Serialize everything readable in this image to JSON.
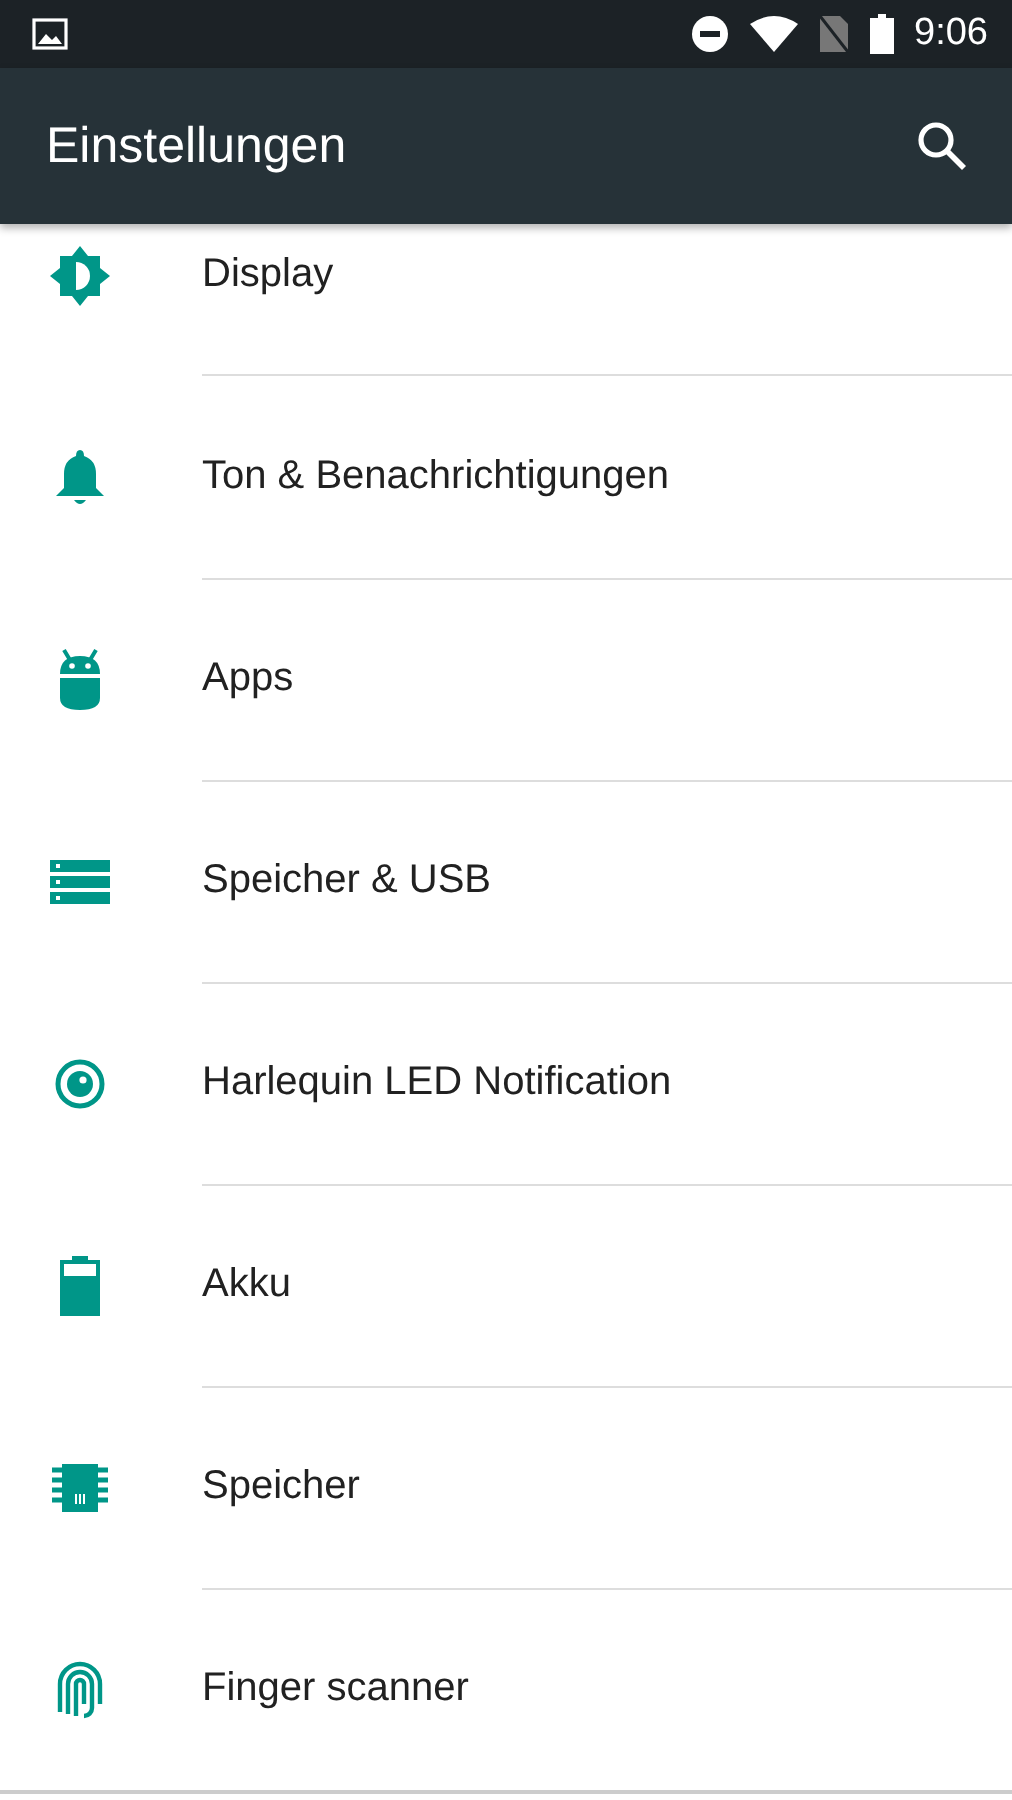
{
  "status_bar": {
    "time": "9:06"
  },
  "app_bar": {
    "title": "Einstellungen"
  },
  "items": [
    {
      "label": "Display",
      "kind": "display"
    },
    {
      "label": "Ton & Benachrichtigungen",
      "kind": "bell"
    },
    {
      "label": "Apps",
      "kind": "android"
    },
    {
      "label": "Speicher & USB",
      "kind": "storage"
    },
    {
      "label": "Harlequin LED Notification",
      "kind": "led"
    },
    {
      "label": "Akku",
      "kind": "battery"
    },
    {
      "label": "Speicher",
      "kind": "chip"
    },
    {
      "label": "Finger scanner",
      "kind": "fingerprint"
    }
  ]
}
